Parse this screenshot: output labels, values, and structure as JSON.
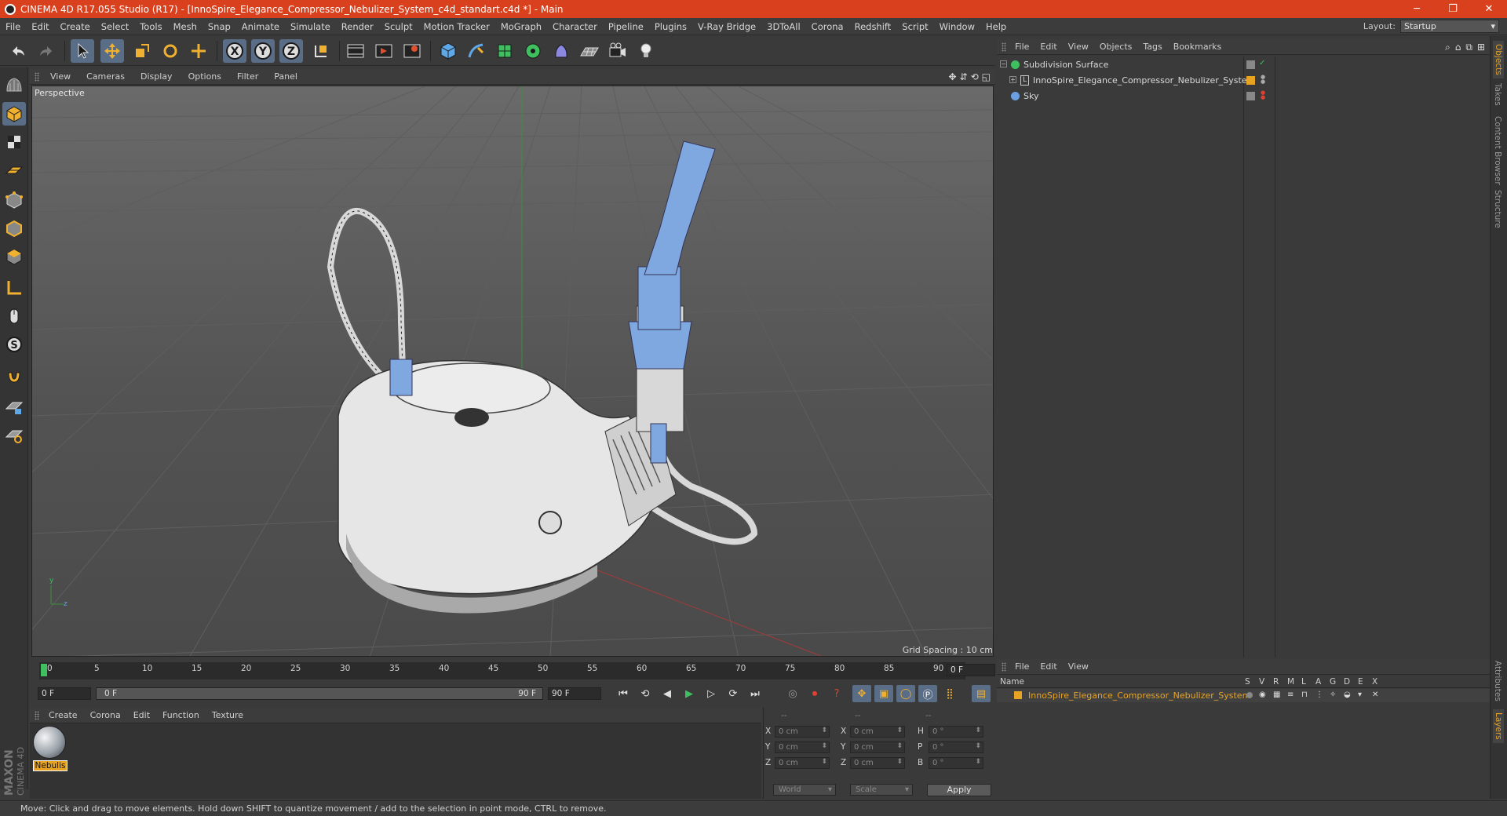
{
  "window": {
    "title": "CINEMA 4D R17.055 Studio (R17) - [InnoSpire_Elegance_Compressor_Nebulizer_System_c4d_standart.c4d *] - Main",
    "minimize": "─",
    "restore": "❐",
    "close": "✕"
  },
  "menu": {
    "items": [
      "File",
      "Edit",
      "Create",
      "Select",
      "Tools",
      "Mesh",
      "Snap",
      "Animate",
      "Simulate",
      "Render",
      "Sculpt",
      "Motion Tracker",
      "MoGraph",
      "Character",
      "Pipeline",
      "Plugins",
      "V-Ray Bridge",
      "3DToAll",
      "Corona",
      "Redshift",
      "Script",
      "Window",
      "Help"
    ],
    "layout_label": "Layout:",
    "layout_value": "Startup"
  },
  "viewport": {
    "menu": [
      "View",
      "Cameras",
      "Display",
      "Options",
      "Filter",
      "Panel"
    ],
    "label": "Perspective",
    "grid_spacing": "Grid Spacing : 10 cm"
  },
  "timeline": {
    "ticks": [
      "0",
      "5",
      "10",
      "15",
      "20",
      "25",
      "30",
      "35",
      "40",
      "45",
      "50",
      "55",
      "60",
      "65",
      "70",
      "75",
      "80",
      "85",
      "90"
    ],
    "current_frame": "0 F",
    "start_field": "0 F",
    "range_start": "0 F",
    "range_end": "90 F",
    "end_field": "90 F"
  },
  "material_manager": {
    "menu": [
      "Create",
      "Corona",
      "Edit",
      "Function",
      "Texture"
    ],
    "material_name": "Nebulis"
  },
  "coordinates": {
    "header": [
      "--",
      "--",
      "--"
    ],
    "rows": [
      {
        "a": "X",
        "av": "0 cm",
        "b": "X",
        "bv": "0 cm",
        "c": "H",
        "cv": "0 °"
      },
      {
        "a": "Y",
        "av": "0 cm",
        "b": "Y",
        "bv": "0 cm",
        "c": "P",
        "cv": "0 °"
      },
      {
        "a": "Z",
        "av": "0 cm",
        "b": "Z",
        "bv": "0 cm",
        "c": "B",
        "cv": "0 °"
      }
    ],
    "world": "World",
    "scale": "Scale",
    "apply": "Apply"
  },
  "object_manager": {
    "menu": [
      "File",
      "Edit",
      "View",
      "Objects",
      "Tags",
      "Bookmarks"
    ],
    "objects": [
      {
        "name": "Subdivision Surface",
        "icon_color": "#3fbf5f"
      },
      {
        "name": "InnoSpire_Elegance_Compressor_Nebulizer_System",
        "icon_color": "#d0d0d0"
      },
      {
        "name": "Sky",
        "icon_color": "#6aa0e0"
      }
    ]
  },
  "layer_manager": {
    "menu": [
      "File",
      "Edit",
      "View"
    ],
    "columns": [
      "Name",
      "S",
      "V",
      "R",
      "M",
      "L",
      "A",
      "G",
      "D",
      "E",
      "X"
    ],
    "layer_name": "InnoSpire_Elegance_Compressor_Nebulizer_System",
    "layer_color": "#e8a322"
  },
  "side_tabs": [
    "Objects",
    "Takes",
    "Content Browser",
    "Structure"
  ],
  "side_tabs_lower": [
    "Attributes",
    "Layers"
  ],
  "status": "Move: Click and drag to move elements. Hold down SHIFT to quantize movement / add to the selection in point mode, CTRL to remove.",
  "branding": {
    "line1": "MAXON",
    "line2": "CINEMA 4D"
  },
  "colors": {
    "accent": "#d9411e",
    "selection": "#5a6d86",
    "material": "#e8a322",
    "model_blue": "#7fa8e0"
  }
}
